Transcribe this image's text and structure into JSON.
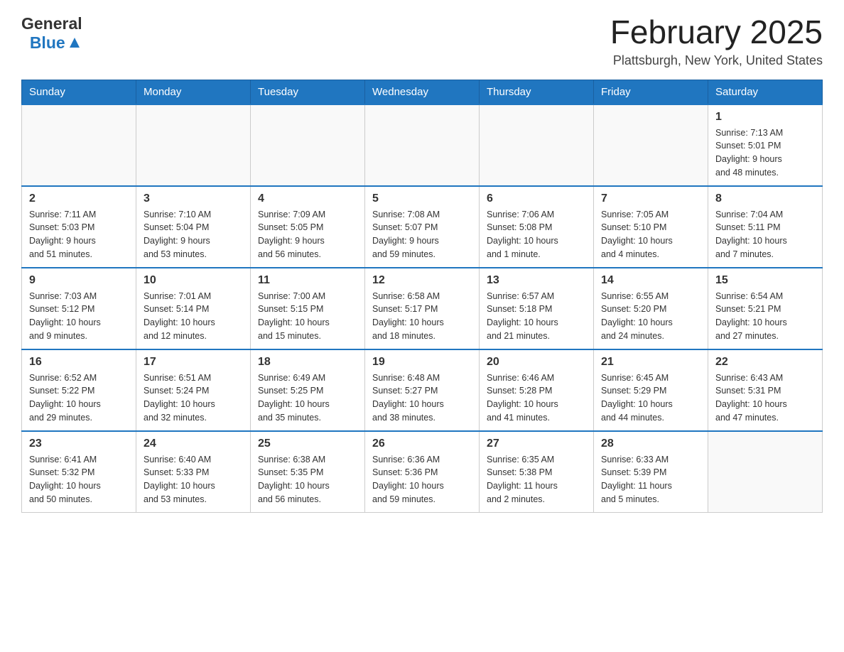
{
  "header": {
    "logo_general": "General",
    "logo_blue": "Blue",
    "month_title": "February 2025",
    "location": "Plattsburgh, New York, United States"
  },
  "weekdays": [
    "Sunday",
    "Monday",
    "Tuesday",
    "Wednesday",
    "Thursday",
    "Friday",
    "Saturday"
  ],
  "weeks": [
    [
      {
        "day": "",
        "info": ""
      },
      {
        "day": "",
        "info": ""
      },
      {
        "day": "",
        "info": ""
      },
      {
        "day": "",
        "info": ""
      },
      {
        "day": "",
        "info": ""
      },
      {
        "day": "",
        "info": ""
      },
      {
        "day": "1",
        "info": "Sunrise: 7:13 AM\nSunset: 5:01 PM\nDaylight: 9 hours\nand 48 minutes."
      }
    ],
    [
      {
        "day": "2",
        "info": "Sunrise: 7:11 AM\nSunset: 5:03 PM\nDaylight: 9 hours\nand 51 minutes."
      },
      {
        "day": "3",
        "info": "Sunrise: 7:10 AM\nSunset: 5:04 PM\nDaylight: 9 hours\nand 53 minutes."
      },
      {
        "day": "4",
        "info": "Sunrise: 7:09 AM\nSunset: 5:05 PM\nDaylight: 9 hours\nand 56 minutes."
      },
      {
        "day": "5",
        "info": "Sunrise: 7:08 AM\nSunset: 5:07 PM\nDaylight: 9 hours\nand 59 minutes."
      },
      {
        "day": "6",
        "info": "Sunrise: 7:06 AM\nSunset: 5:08 PM\nDaylight: 10 hours\nand 1 minute."
      },
      {
        "day": "7",
        "info": "Sunrise: 7:05 AM\nSunset: 5:10 PM\nDaylight: 10 hours\nand 4 minutes."
      },
      {
        "day": "8",
        "info": "Sunrise: 7:04 AM\nSunset: 5:11 PM\nDaylight: 10 hours\nand 7 minutes."
      }
    ],
    [
      {
        "day": "9",
        "info": "Sunrise: 7:03 AM\nSunset: 5:12 PM\nDaylight: 10 hours\nand 9 minutes."
      },
      {
        "day": "10",
        "info": "Sunrise: 7:01 AM\nSunset: 5:14 PM\nDaylight: 10 hours\nand 12 minutes."
      },
      {
        "day": "11",
        "info": "Sunrise: 7:00 AM\nSunset: 5:15 PM\nDaylight: 10 hours\nand 15 minutes."
      },
      {
        "day": "12",
        "info": "Sunrise: 6:58 AM\nSunset: 5:17 PM\nDaylight: 10 hours\nand 18 minutes."
      },
      {
        "day": "13",
        "info": "Sunrise: 6:57 AM\nSunset: 5:18 PM\nDaylight: 10 hours\nand 21 minutes."
      },
      {
        "day": "14",
        "info": "Sunrise: 6:55 AM\nSunset: 5:20 PM\nDaylight: 10 hours\nand 24 minutes."
      },
      {
        "day": "15",
        "info": "Sunrise: 6:54 AM\nSunset: 5:21 PM\nDaylight: 10 hours\nand 27 minutes."
      }
    ],
    [
      {
        "day": "16",
        "info": "Sunrise: 6:52 AM\nSunset: 5:22 PM\nDaylight: 10 hours\nand 29 minutes."
      },
      {
        "day": "17",
        "info": "Sunrise: 6:51 AM\nSunset: 5:24 PM\nDaylight: 10 hours\nand 32 minutes."
      },
      {
        "day": "18",
        "info": "Sunrise: 6:49 AM\nSunset: 5:25 PM\nDaylight: 10 hours\nand 35 minutes."
      },
      {
        "day": "19",
        "info": "Sunrise: 6:48 AM\nSunset: 5:27 PM\nDaylight: 10 hours\nand 38 minutes."
      },
      {
        "day": "20",
        "info": "Sunrise: 6:46 AM\nSunset: 5:28 PM\nDaylight: 10 hours\nand 41 minutes."
      },
      {
        "day": "21",
        "info": "Sunrise: 6:45 AM\nSunset: 5:29 PM\nDaylight: 10 hours\nand 44 minutes."
      },
      {
        "day": "22",
        "info": "Sunrise: 6:43 AM\nSunset: 5:31 PM\nDaylight: 10 hours\nand 47 minutes."
      }
    ],
    [
      {
        "day": "23",
        "info": "Sunrise: 6:41 AM\nSunset: 5:32 PM\nDaylight: 10 hours\nand 50 minutes."
      },
      {
        "day": "24",
        "info": "Sunrise: 6:40 AM\nSunset: 5:33 PM\nDaylight: 10 hours\nand 53 minutes."
      },
      {
        "day": "25",
        "info": "Sunrise: 6:38 AM\nSunset: 5:35 PM\nDaylight: 10 hours\nand 56 minutes."
      },
      {
        "day": "26",
        "info": "Sunrise: 6:36 AM\nSunset: 5:36 PM\nDaylight: 10 hours\nand 59 minutes."
      },
      {
        "day": "27",
        "info": "Sunrise: 6:35 AM\nSunset: 5:38 PM\nDaylight: 11 hours\nand 2 minutes."
      },
      {
        "day": "28",
        "info": "Sunrise: 6:33 AM\nSunset: 5:39 PM\nDaylight: 11 hours\nand 5 minutes."
      },
      {
        "day": "",
        "info": ""
      }
    ]
  ]
}
